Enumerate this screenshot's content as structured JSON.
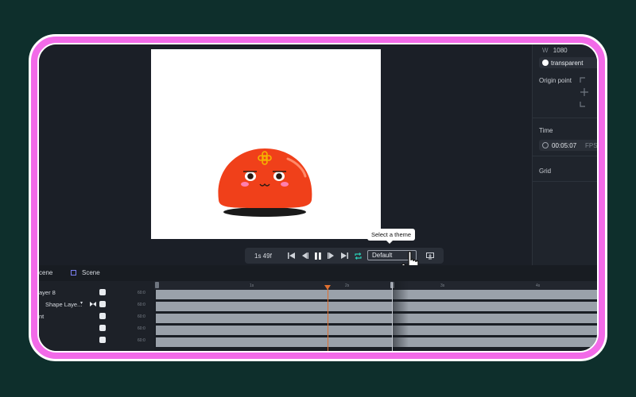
{
  "right_panel": {
    "resolution_value": "1080",
    "background_value": "transparent",
    "origin_point_label": "Origin point",
    "time_label": "Time",
    "duration_value": "00:05:07",
    "fps_label": "FPS",
    "grid_label": "Grid"
  },
  "playback": {
    "current_time": "1s 49f",
    "theme_selected": "Default",
    "tooltip": "Select a theme"
  },
  "timeline": {
    "tabs": [
      {
        "label": "cene"
      },
      {
        "label": "Scene"
      }
    ],
    "ruler_ticks": [
      "1s",
      "2s",
      "3s",
      "4s"
    ],
    "layers": [
      {
        "name": "ayer 8",
        "badge": "60:0"
      },
      {
        "name": "Shape Laye...",
        "badge": "60:0"
      },
      {
        "name": "nt",
        "badge": "60:0"
      },
      {
        "name": "",
        "badge": "60:0"
      },
      {
        "name": "",
        "badge": "60:0"
      }
    ]
  },
  "colors": {
    "frame": "#f26ae8",
    "background": "#0e2f2c",
    "character": "#f0401a",
    "playhead": "#e07030"
  }
}
